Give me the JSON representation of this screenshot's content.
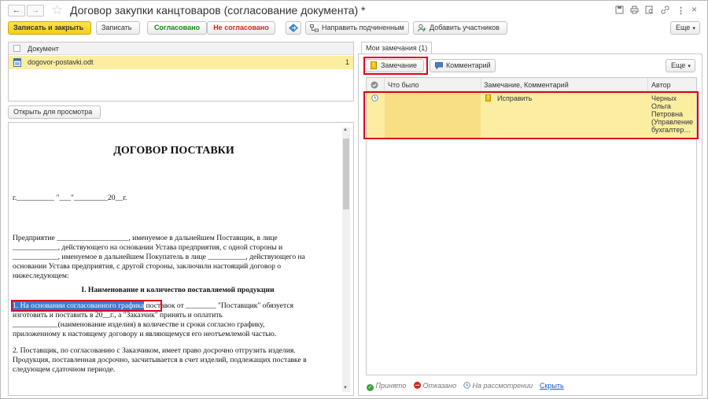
{
  "window": {
    "title": "Договор закупки канцтоваров (согласование документа) *"
  },
  "titlebar_icons": [
    "save-icon",
    "print-icon",
    "preview-icon",
    "link-icon",
    "more-vert-icon",
    "close-icon"
  ],
  "toolbar": {
    "save_close": "Записать и закрыть",
    "save": "Записать",
    "approved": "Согласовано",
    "not_approved": "Не согласовано",
    "send_subordinate": "Направить подчиненным",
    "add_participants": "Добавить участников",
    "more": "Еще"
  },
  "documents": {
    "column_header": "Документ",
    "rows": [
      {
        "name": "dogovor-postavki.odt",
        "count": "1"
      }
    ]
  },
  "open_view_button": "Открыть для просмотра",
  "doc_preview": {
    "title": "ДОГОВОР ПОСТАВКИ",
    "date_line": "г.__________ \"___\"_________20__г.",
    "para1": [
      "Предприятие ___________________, именуемое в дальнейшем Поставщик, в лице",
      "____________, действующего на основании Устава предприятия, с одной стороны и",
      "____________, именуемое в дальнейшем Покупатель в лице __________, действующего на",
      "основании Устава предприятия, с другой стороны, заключили настоящий договор о",
      "нижеследующем:"
    ],
    "section_title": "I. Наименование и количество поставляемой продукции",
    "highlight": "1. На основании согласованного графика",
    "item1_rest": " поставок от ________ \"Поставщик\" обязуется",
    "item1_lines": [
      "изготовить и поставить в 20__г., а \"Заказчик\" принять и оплатить",
      "____________(наименование изделия) в количестве и сроки согласно графику,",
      "приложенному к настоящему договору и являющемуся его неотъемлемой частью."
    ],
    "item2_lines": [
      "2. Поставщик, по согласованию с Заказчиком, имеет право досрочно отгрузить изделия.",
      "Продукция, поставленная досрочно, засчитывается в счет изделий, подлежащих поставке в",
      "следующем сдаточном периоде."
    ]
  },
  "remarks": {
    "tab_label": "Мои замечания (1)",
    "remark_button": "Замечание",
    "comment_button": "Комментарий",
    "more": "Еще",
    "columns": {
      "was": "Что было",
      "remark": "Замечание, Комментарий",
      "author": "Автор"
    },
    "rows": [
      {
        "was": "",
        "remark": "Исправить",
        "author_lines": [
          "Черных",
          "Ольга",
          "Петровна",
          "(Управление",
          "бухгалтер…"
        ]
      }
    ]
  },
  "legend": {
    "accepted": "Принято",
    "rejected": "Отказано",
    "review": "На рассмотрении",
    "hide": "Скрыть"
  },
  "colors": {
    "accent_yellow": "#f2cf1a",
    "selection_yellow": "#fbeea0",
    "highlight_red": "#e0001b",
    "approved_green": "#1a8a1a",
    "rejected_red": "#d9261c",
    "link_blue": "#1a55c9"
  }
}
